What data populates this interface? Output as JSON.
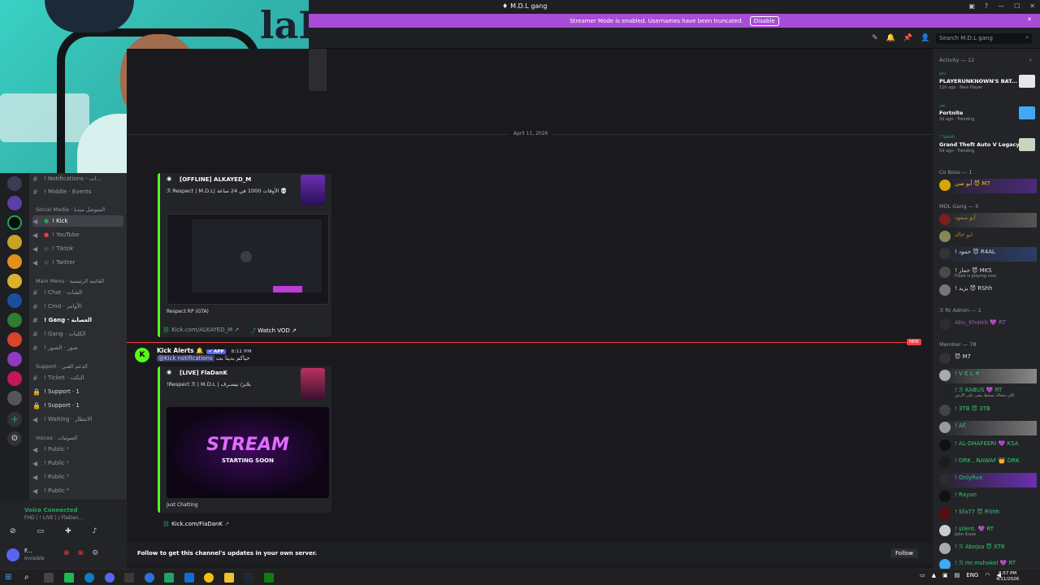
{
  "window": {
    "title": "M.D.L gang",
    "server_glyph": "♦"
  },
  "banner": {
    "text": "Streamer Mode is enabled. Usernames have been truncated.",
    "disable_label": "Disable"
  },
  "header": {
    "search_placeholder": "Search M.D.L gang"
  },
  "webcam": {
    "wall_text": "laD"
  },
  "channels": {
    "top_items": [
      "! Notifications - ات...",
      "! Middle · Events"
    ],
    "social_category": "Social Media · السوشل ميديا",
    "social": [
      "! Kick",
      "! YouTube",
      "! Tiktok",
      "! Twitter"
    ],
    "main_category": "Main Menu · القائمة الرئيسية",
    "main": [
      "! Chat · الشات",
      "! Cmd · الأوامر",
      "! Gang · العصابة",
      "! Gang · الكليات",
      "! صور · الصور"
    ],
    "support_category": "Support · الدعم الفني",
    "support": [
      "! Ticket · التكت",
      "! Support · 1",
      "! Support · 1",
      "! Waiting · الانتظار"
    ],
    "voice_category": "Voices · الصوتيات",
    "voices": [
      "! Public ¹",
      "! Public ²",
      "! Public ³",
      "! Public ⁴"
    ]
  },
  "voice_panel": {
    "status": "Voice Connected",
    "sub": "FHD | ! LIVE | / FlaDan..."
  },
  "user_panel": {
    "name": "F...",
    "status": "Invisible"
  },
  "chat": {
    "date_divider": "April 11, 2026",
    "embed1": {
      "name": "[OFFLINE] ALKAYED_M",
      "desc": "ℛ Respect | M.D.L| الأوقات 1000 في 24 ساعة 💀",
      "footer": "Respect RP (GTA)",
      "link": "Kick.com/ALKAYED_M",
      "watch": "Watch VOD"
    },
    "new_badge": "NEW",
    "message": {
      "author": "Kick Alerts 🔔",
      "badge": "✔ APP",
      "time": "8:11 PM",
      "mention": "@Kick notifications",
      "text": "حياكم بدينا بث"
    },
    "embed2": {
      "name": "[LIVE] FlaDanK",
      "desc": "!Respect ℛ | M.D.L | بلايز/ تيسـرف",
      "footer": "Just Chatting",
      "link": "Kick.com/FlaDanK",
      "image_title": "STREAM",
      "image_sub": "STARTING SOON"
    },
    "follow_text": "Follow to get this channel's updates in your own server.",
    "follow_button": "Follow"
  },
  "members": {
    "activity_header": "Activity — 12",
    "activities": [
      {
        "name": "Jav",
        "game": "PLAYERUNKNOWN'S BAT...",
        "time": "12h ago · New Player"
      },
      {
        "name": "نمر",
        "game": "Fortnite",
        "time": "2d ago · Trending"
      },
      {
        "name": "! Saleh",
        "game": "Grand Theft Auto V Legacy",
        "time": "5d ago · Trending"
      }
    ],
    "coboss_header": "Co Boss — 1",
    "coboss": [
      "أبو ضي 😈 M7"
    ],
    "gang_header": "MDL Gang — 5",
    "gang": [
      "أبو سعود",
      "ابو خالد",
      "! حمود 😈 R4AL",
      "! حمار 😈 MKS",
      "! يزيد 😈 RShh"
    ],
    "gang_status": "Freek is playing now",
    "rtadmin_header": "ℛ Rt Admin — 1",
    "rtadmin": [
      "Abu_Khaleb 💜 RT"
    ],
    "member_header": "Member — 78",
    "member_list": [
      "😈 M7",
      "! V E L ⚜",
      "! ℛ KABUS 💜 RT",
      "! 3TB 😈 3TB",
      "! AF.",
      "! AL-DHAFEERI 💜 KSA",
      "! DRK , NAWAF 👑 DRK",
      "! OnlyRvx",
      "! Rayan",
      "! Sfa77 😈 RShh",
      "! silent. 💜 RT",
      "! ℛ Abojsa 😈 XT8",
      "! ℛ mr.mshakel 💜 RT"
    ],
    "member_status_1": "اللي شغالة تسقط يبقى على الأرض",
    "member_status_2": "John Snow"
  },
  "taskbar": {
    "lang": "ENG",
    "time": "8:57 PM",
    "date": "4/11/2026"
  }
}
